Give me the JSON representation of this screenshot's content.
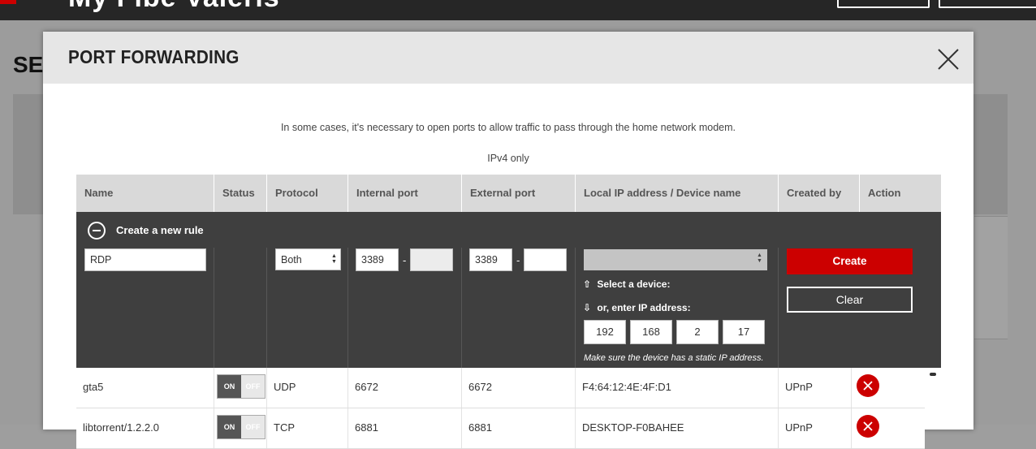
{
  "background": {
    "brand": "My Fibe Valeris",
    "page_title": "SER"
  },
  "modal": {
    "title": "PORT FORWARDING",
    "intro": "In some cases, it's necessary to open ports to allow traffic to pass through the home network modem.",
    "ipv4_note": "IPv4 only"
  },
  "table": {
    "headers": [
      "Name",
      "Status",
      "Protocol",
      "Internal port",
      "External port",
      "Local IP address / Device name",
      "Created by",
      "Action"
    ]
  },
  "create_rule": {
    "label": "Create a new rule",
    "name_value": "RDP",
    "protocol_value": "Both",
    "internal_port_start": "3389",
    "internal_port_end": "",
    "external_port_start": "3389",
    "external_port_end": "",
    "dash": "-",
    "device_select_value": "",
    "select_device_hint": "Select a device:",
    "enter_ip_hint": "or, enter IP address:",
    "ip_octets": [
      "192",
      "168",
      "2",
      "17"
    ],
    "static_ip_note": "Make sure the device has a static IP address.",
    "create_label": "Create",
    "clear_label": "Clear",
    "up_arrow": "⇧",
    "down_arrow": "⇩"
  },
  "rules": [
    {
      "name": "gta5",
      "status_on": "ON",
      "status_off": "OFF",
      "protocol": "UDP",
      "internal_port": "6672",
      "external_port": "6672",
      "device": "F4:64:12:4E:4F:D1",
      "created_by": "UPnP"
    },
    {
      "name": "libtorrent/1.2.2.0",
      "status_on": "ON",
      "status_off": "OFF",
      "protocol": "TCP",
      "internal_port": "6881",
      "external_port": "6881",
      "device": "DESKTOP-F0BAHEE",
      "created_by": "UPnP"
    }
  ],
  "colors": {
    "accent_red": "#cc0000",
    "create_area_bg": "#3f3f3f",
    "header_bg": "#d9d9d9"
  }
}
